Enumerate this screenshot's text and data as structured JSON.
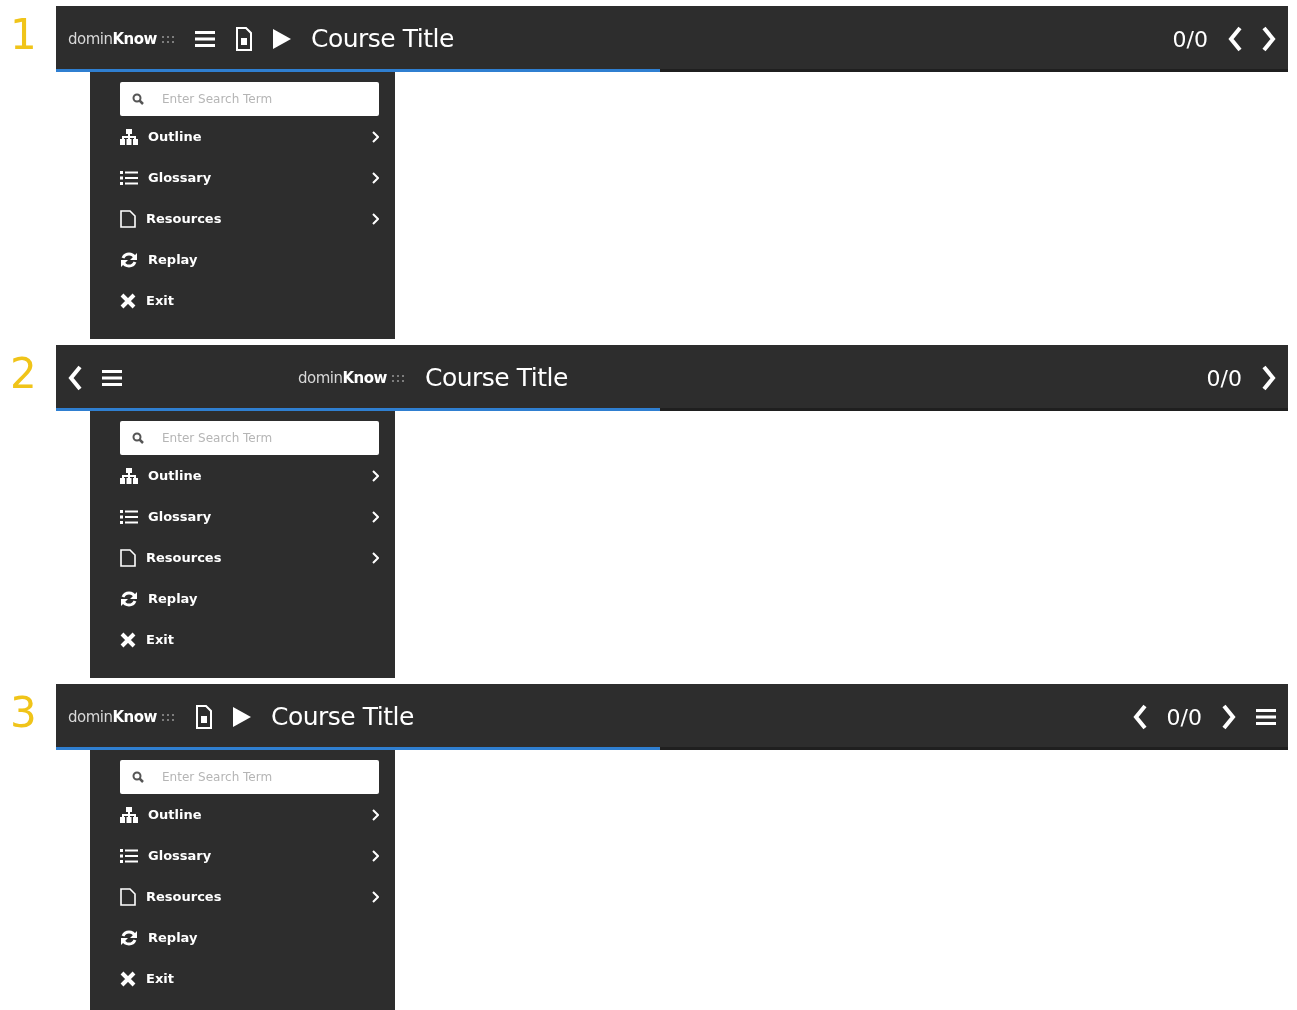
{
  "variants": [
    {
      "number": "1",
      "progress": {
        "level": 0.49
      },
      "start": [
        {
          "kind": "logo",
          "text": "domin**Know**"
        },
        {
          "kind": "menu"
        },
        {
          "kind": "document"
        },
        {
          "kind": "play"
        },
        {
          "kind": "title",
          "text": "Course Title"
        }
      ],
      "end": [
        {
          "kind": "counter",
          "text": "0/0"
        },
        {
          "kind": "prev"
        },
        {
          "kind": "next"
        }
      ],
      "menu": {
        "placeholder": "Enter Search Term",
        "items": [
          {
            "label": "Outline",
            "submenu": true
          },
          {
            "label": "Glossary",
            "submenu": true
          },
          {
            "label": "Resources",
            "submenu": true
          },
          {
            "label": "Replay",
            "submenu": false
          },
          {
            "label": "Exit",
            "submenu": false
          }
        ]
      }
    },
    {
      "number": "2",
      "progress": {
        "level": 0.49
      },
      "start": [
        {
          "kind": "prev"
        },
        {
          "kind": "menu"
        }
      ],
      "center": [
        {
          "kind": "logo",
          "text": "domin**Know**"
        },
        {
          "kind": "title",
          "text": "Course Title"
        }
      ],
      "end": [
        {
          "kind": "counter",
          "text": "0/0"
        },
        {
          "kind": "next"
        }
      ],
      "menu": {
        "placeholder": "Enter Search Term",
        "items": [
          {
            "label": "Outline",
            "submenu": true
          },
          {
            "label": "Glossary",
            "submenu": true
          },
          {
            "label": "Resources",
            "submenu": true
          },
          {
            "label": "Replay",
            "submenu": false
          },
          {
            "label": "Exit",
            "submenu": false
          }
        ]
      }
    },
    {
      "number": "3",
      "progress": {
        "level": 0.49
      },
      "start": [
        {
          "kind": "logo",
          "text": "domin**Know**"
        },
        {
          "kind": "document"
        },
        {
          "kind": "play"
        },
        {
          "kind": "title",
          "text": "Course Title"
        }
      ],
      "end": [
        {
          "kind": "prev"
        },
        {
          "kind": "counter",
          "text": "0/0"
        },
        {
          "kind": "next"
        },
        {
          "kind": "menu"
        }
      ],
      "menu": {
        "placeholder": "Enter Search Term",
        "items": [
          {
            "label": "Outline",
            "submenu": true
          },
          {
            "label": "Glossary",
            "submenu": true
          },
          {
            "label": "Resources",
            "submenu": true
          },
          {
            "label": "Replay",
            "submenu": false
          },
          {
            "label": "Exit",
            "submenu": false
          }
        ]
      }
    }
  ]
}
